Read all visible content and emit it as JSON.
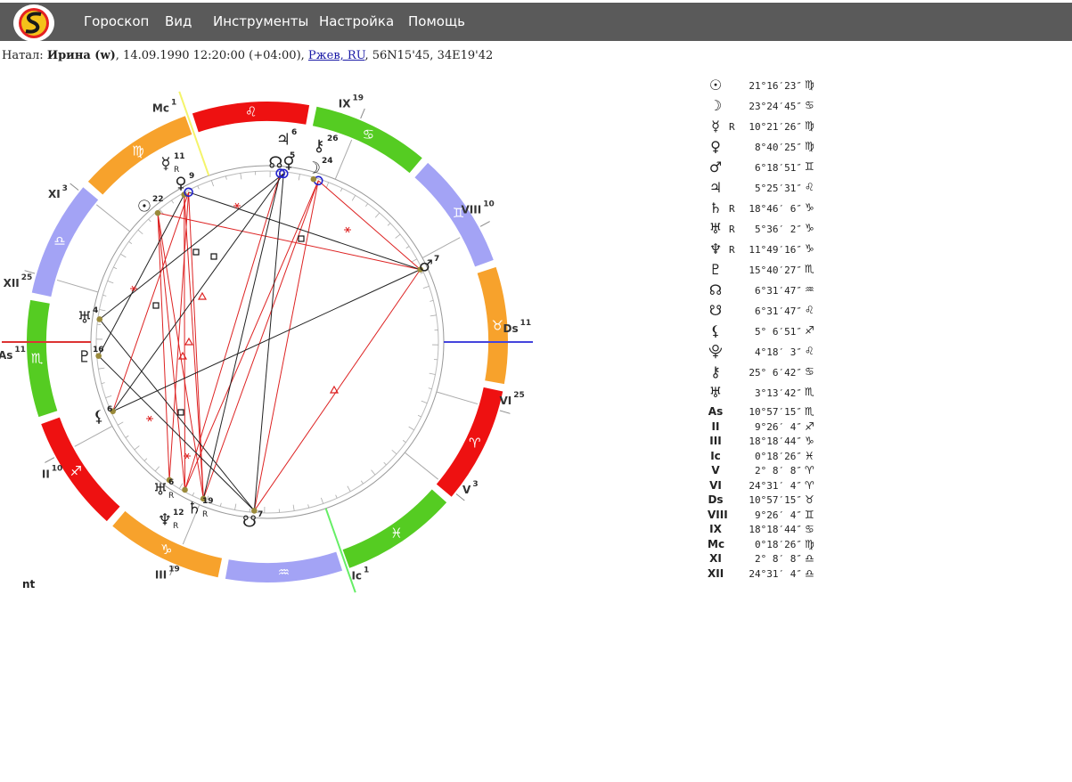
{
  "menu": {
    "items": [
      "Гороскоп",
      "Вид",
      "Инструменты",
      "Настройка",
      "Помощь"
    ]
  },
  "natal": {
    "prefix": "Натал:",
    "name": "Ирина (w)",
    "datetime": ", 14.09.1990 12:20:00 (+04:00), ",
    "place": "Ржев, RU",
    "coords": ", 56N15'45, 34E19'42"
  },
  "chart": {
    "footer_label": "nt",
    "sign_colors": {
      "fire": "#ee1111",
      "earth": "#f7a22c",
      "air": "#a3a3f5",
      "water": "#55cc22"
    },
    "axis_colors": {
      "mc": "#f4f46a",
      "ic": "#66ee66",
      "asc": "#dd3333",
      "desc": "#4444dd"
    },
    "zodiac_signs": [
      {
        "name": "aries",
        "glyph": "♈"
      },
      {
        "name": "taurus",
        "glyph": "♉"
      },
      {
        "name": "gemini",
        "glyph": "♊"
      },
      {
        "name": "cancer",
        "glyph": "♋"
      },
      {
        "name": "leo",
        "glyph": "♌"
      },
      {
        "name": "virgo",
        "glyph": "♍"
      },
      {
        "name": "libra",
        "glyph": "♎"
      },
      {
        "name": "scorpio",
        "glyph": "♏"
      },
      {
        "name": "sagittarius",
        "glyph": "♐"
      },
      {
        "name": "capricorn",
        "glyph": "♑"
      },
      {
        "name": "aquarius",
        "glyph": "♒"
      },
      {
        "name": "pisces",
        "glyph": "♓"
      }
    ],
    "house_labels": [
      {
        "name": "as",
        "label": "As",
        "deg": "11"
      },
      {
        "name": "ii",
        "label": "II",
        "deg": "10"
      },
      {
        "name": "iii",
        "label": "III",
        "deg": "19"
      },
      {
        "name": "ic",
        "label": "Ic",
        "deg": "1"
      },
      {
        "name": "v",
        "label": "V",
        "deg": "3"
      },
      {
        "name": "vi",
        "label": "VI",
        "deg": "25"
      },
      {
        "name": "ds",
        "label": "Ds",
        "deg": "11"
      },
      {
        "name": "viii",
        "label": "VIII",
        "deg": "10"
      },
      {
        "name": "ix",
        "label": "IX",
        "deg": "19"
      },
      {
        "name": "mc",
        "label": "Mc",
        "deg": "1"
      },
      {
        "name": "xi",
        "label": "XI",
        "deg": "3"
      },
      {
        "name": "xii",
        "label": "XII",
        "deg": "25"
      }
    ],
    "planet_labels": [
      {
        "name": "jupiter",
        "glyph": "♃",
        "deg": "6",
        "retro": ""
      },
      {
        "name": "node-group",
        "glyph": "☊♀",
        "deg": "5",
        "retro": ""
      },
      {
        "name": "chiron",
        "glyph": "⚷",
        "deg": "26",
        "retro": ""
      },
      {
        "name": "moon",
        "glyph": "☽",
        "deg": "24",
        "retro": ""
      },
      {
        "name": "mercury",
        "glyph": "☿",
        "deg": "11",
        "retro": "R"
      },
      {
        "name": "venus",
        "glyph": "♀",
        "deg": "9",
        "retro": ""
      },
      {
        "name": "sun",
        "glyph": "☉",
        "deg": "22",
        "retro": ""
      },
      {
        "name": "mars",
        "glyph": "♂",
        "deg": "7",
        "retro": ""
      },
      {
        "name": "uranus-house",
        "glyph": "♅",
        "deg": "4",
        "retro": ""
      },
      {
        "name": "pluto",
        "glyph": "♇",
        "deg": "16",
        "retro": ""
      },
      {
        "name": "lilith",
        "glyph": "⚸",
        "deg": "6",
        "retro": ""
      },
      {
        "name": "uranus",
        "glyph": "♅",
        "deg": "6",
        "retro": "R"
      },
      {
        "name": "saturn",
        "glyph": "♄",
        "deg": "19",
        "retro": "R"
      },
      {
        "name": "neptune",
        "glyph": "♆",
        "deg": "12",
        "retro": "R"
      },
      {
        "name": "south-node",
        "glyph": "☋",
        "deg": "7",
        "retro": ""
      }
    ]
  },
  "positions": [
    {
      "name": "sun",
      "glyph": "☉",
      "retro": "",
      "deg": "21°16′23″",
      "sign": "♍"
    },
    {
      "name": "moon",
      "glyph": "☽",
      "retro": "",
      "deg": "23°24′45″",
      "sign": "♋"
    },
    {
      "name": "mercury",
      "glyph": "☿",
      "retro": "R",
      "deg": "10°21′26″",
      "sign": "♍"
    },
    {
      "name": "venus",
      "glyph": "♀",
      "retro": "",
      "deg": "8°40′25″",
      "sign": "♍"
    },
    {
      "name": "mars",
      "glyph": "♂",
      "retro": "",
      "deg": "6°18′51″",
      "sign": "♊"
    },
    {
      "name": "jupiter",
      "glyph": "♃",
      "retro": "",
      "deg": "5°25′31″",
      "sign": "♌"
    },
    {
      "name": "saturn",
      "glyph": "♄",
      "retro": "R",
      "deg": "18°46′ 6″",
      "sign": "♑"
    },
    {
      "name": "uranus",
      "glyph": "♅",
      "retro": "R",
      "deg": "5°36′ 2″",
      "sign": "♑"
    },
    {
      "name": "neptune",
      "glyph": "♆",
      "retro": "R",
      "deg": "11°49′16″",
      "sign": "♑"
    },
    {
      "name": "pluto",
      "glyph": "♇",
      "retro": "",
      "deg": "15°40′27″",
      "sign": "♏"
    },
    {
      "name": "north-node",
      "glyph": "☊",
      "retro": "",
      "deg": "6°31′47″",
      "sign": "♒"
    },
    {
      "name": "south-node",
      "glyph": "☋",
      "retro": "",
      "deg": "6°31′47″",
      "sign": "♌"
    },
    {
      "name": "lilith",
      "glyph": "⚸",
      "retro": "",
      "deg": "5° 6′51″",
      "sign": "♐"
    },
    {
      "name": "selena",
      "glyph": "⯓",
      "retro": "",
      "deg": "4°18′ 3″",
      "sign": "♌"
    },
    {
      "name": "chiron",
      "glyph": "⚷",
      "retro": "",
      "deg": "25° 6′42″",
      "sign": "♋"
    },
    {
      "name": "uranus-alt",
      "glyph": "♅",
      "retro": "",
      "deg": "3°13′42″",
      "sign": "♏"
    }
  ],
  "houses": [
    {
      "name": "as",
      "label": "As",
      "deg": "10°57′15″",
      "sign": "♏"
    },
    {
      "name": "ii",
      "label": "II",
      "deg": "9°26′ 4″",
      "sign": "♐"
    },
    {
      "name": "iii",
      "label": "III",
      "deg": "18°18′44″",
      "sign": "♑"
    },
    {
      "name": "ic",
      "label": "Ic",
      "deg": "0°18′26″",
      "sign": "♓"
    },
    {
      "name": "v",
      "label": "V",
      "deg": "2° 8′ 8″",
      "sign": "♈"
    },
    {
      "name": "vi",
      "label": "VI",
      "deg": "24°31′ 4″",
      "sign": "♈"
    },
    {
      "name": "ds",
      "label": "Ds",
      "deg": "10°57′15″",
      "sign": "♉"
    },
    {
      "name": "viii",
      "label": "VIII",
      "deg": "9°26′ 4″",
      "sign": "♊"
    },
    {
      "name": "ix",
      "label": "IX",
      "deg": "18°18′44″",
      "sign": "♋"
    },
    {
      "name": "mc",
      "label": "Mc",
      "deg": "0°18′26″",
      "sign": "♍"
    },
    {
      "name": "xi",
      "label": "XI",
      "deg": "2° 8′ 8″",
      "sign": "♎"
    },
    {
      "name": "xii",
      "label": "XII",
      "deg": "24°31′ 4″",
      "sign": "♎"
    }
  ]
}
